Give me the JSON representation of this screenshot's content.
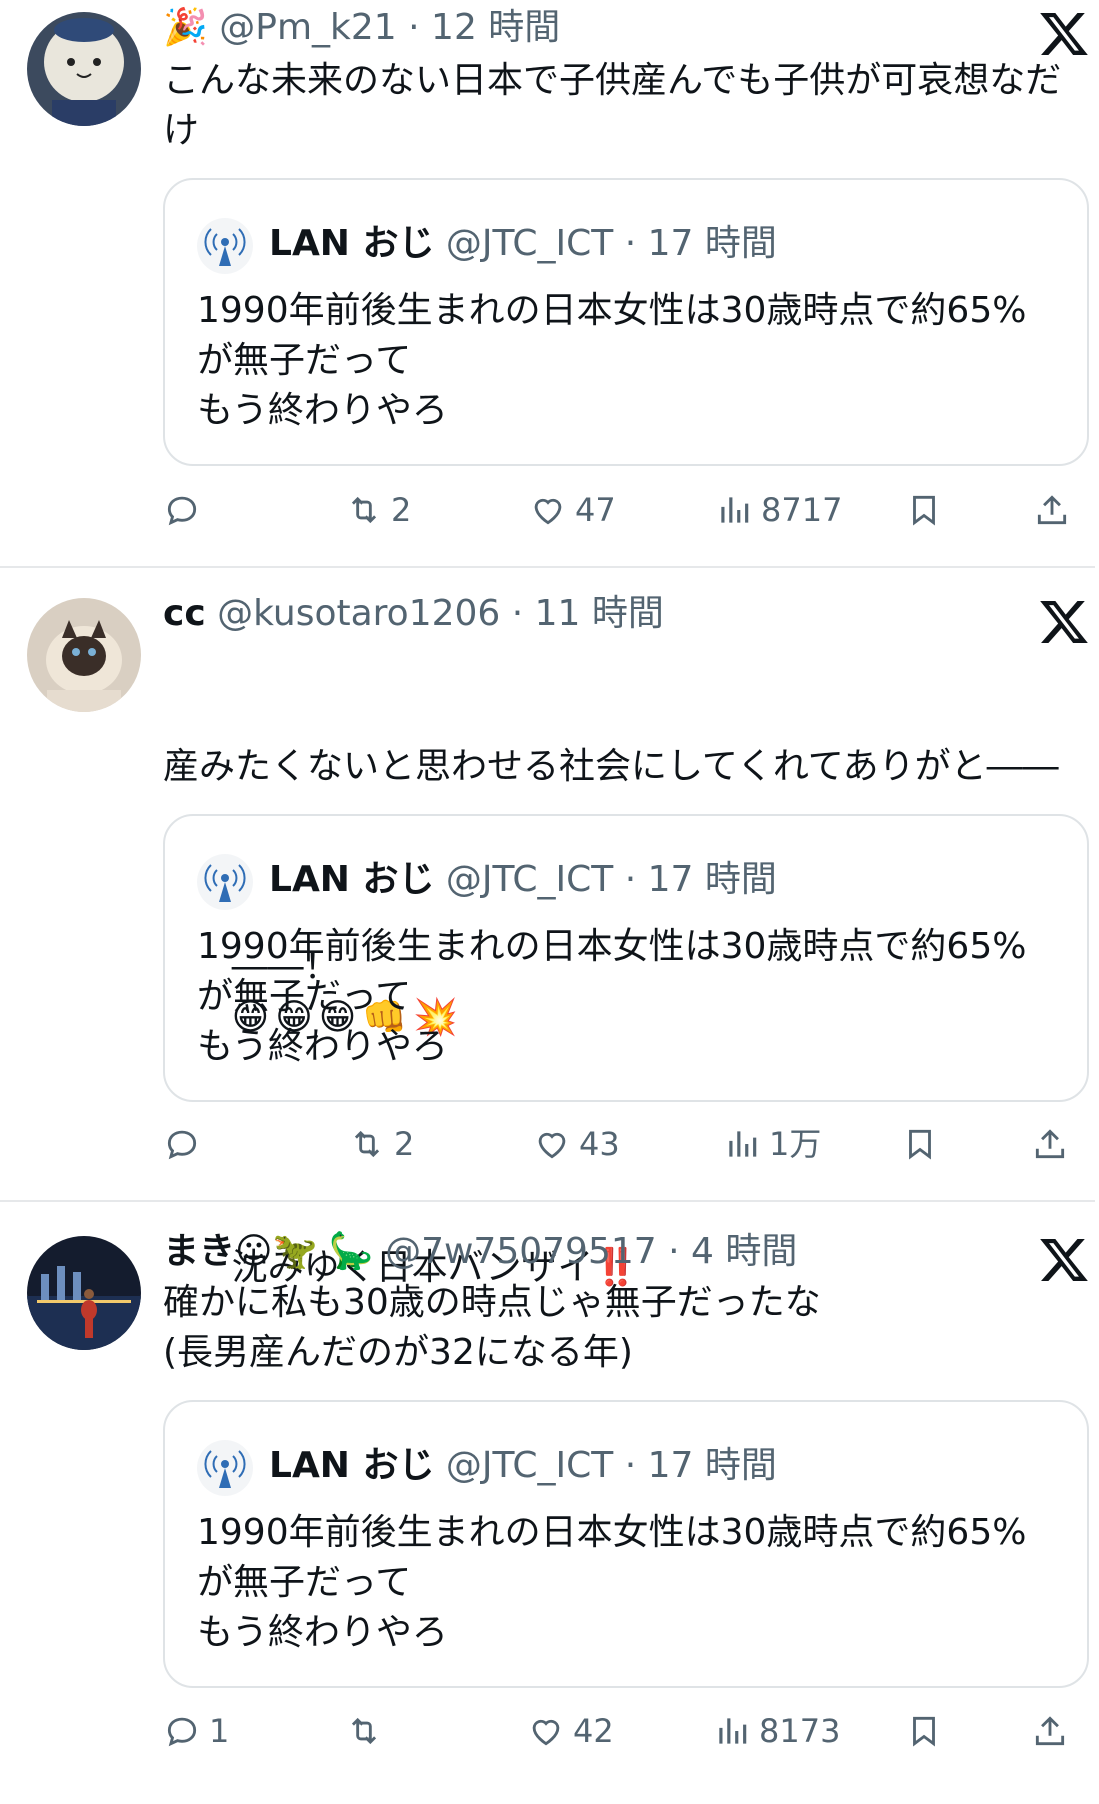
{
  "tweets": [
    {
      "name": "",
      "handle": "@Pm_k21",
      "time": "· 12 時間",
      "name_emoji": "🎉",
      "text": "こんな未来のない日本で子供産んでも子供が可哀想なだけ",
      "quote": {
        "name": "LAN おじ",
        "handle": "@JTC_ICT",
        "time": "· 17 時間",
        "text": "1990年前後生まれの日本女性は30歳時点で約65%\nが無子だって\nもう終わりやろ"
      },
      "actions": {
        "reply": "",
        "retweet": "2",
        "like": "47",
        "views": "8717"
      }
    },
    {
      "name": "cc",
      "handle": "@kusotaro1206",
      "time": "· 11 時間",
      "text_line1": "産みたくないと思わせる社会にしてくれてありがと――",
      "text_line2": "――！",
      "emojis": [
        "😁",
        "😁",
        "😁",
        "👊",
        "💥"
      ],
      "text_line3": "沈みゆく日本バンザイ",
      "text_line3_emoji": "‼️",
      "quote": {
        "name": "LAN おじ",
        "handle": "@JTC_ICT",
        "time": "· 17 時間",
        "text": "1990年前後生まれの日本女性は30歳時点で約65%\nが無子だって\nもう終わりやろ"
      },
      "actions": {
        "reply": "",
        "retweet": "2",
        "like": "43",
        "views": "1万"
      }
    },
    {
      "name": "まき☺",
      "name_emoji": "🦖 🦕",
      "handle": "@7w75079517",
      "time": "· 4 時間",
      "text": "確かに私も30歳の時点じゃ無子だったな\n(長男産んだのが32になる年)",
      "quote": {
        "name": "LAN おじ",
        "handle": "@JTC_ICT",
        "time": "· 17 時間",
        "text": "1990年前後生まれの日本女性は30歳時点で約65%\nが無子だって\nもう終わりやろ"
      },
      "actions": {
        "reply": "1",
        "retweet": "",
        "like": "42",
        "views": "8173"
      }
    }
  ],
  "colors": {
    "text": "#0f1419",
    "secondary": "#536471",
    "border": "#dfe3e6"
  }
}
